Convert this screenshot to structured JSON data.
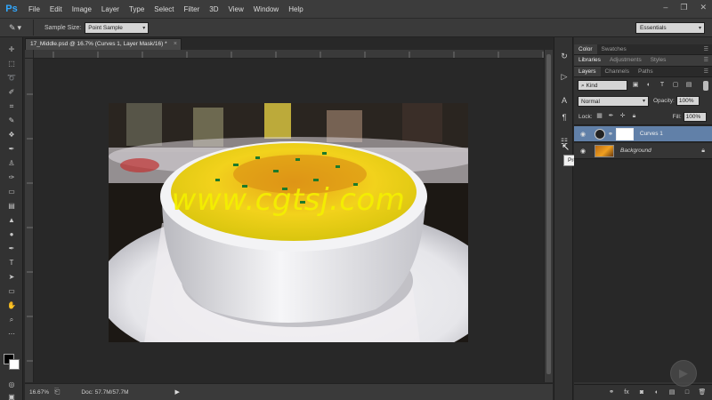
{
  "app": {
    "logo": "Ps",
    "menu": [
      "File",
      "Edit",
      "Image",
      "Layer",
      "Type",
      "Select",
      "Filter",
      "3D",
      "View",
      "Window",
      "Help"
    ],
    "window_controls": [
      "–",
      "❐",
      "✕"
    ]
  },
  "options_bar": {
    "sample_size_label": "Sample Size:",
    "sample_size_value": "Point Sample",
    "workspace": "Essentials"
  },
  "document": {
    "tab_title": "17_Middle.psd @ 16.7% (Curves 1, Layer Mask/16) *",
    "tab_close": "×",
    "watermark": "www.cgtsj.com"
  },
  "status_bar": {
    "zoom": "16.67%",
    "doc_size": "Doc: 57.7M/57.7M"
  },
  "tooltip": "Properties",
  "panels": {
    "row1_tabs": [
      "Color",
      "Swatches"
    ],
    "row2_tabs": [
      "Libraries",
      "Adjustments",
      "Styles"
    ],
    "row3_tabs": [
      "Layers",
      "Channels",
      "Paths"
    ],
    "filter_kind": "Kind",
    "blend_mode": "Normal",
    "opacity_label": "Opacity:",
    "opacity_value": "100%",
    "lock_label": "Lock:",
    "fill_label": "Fill:",
    "fill_value": "100%"
  },
  "layers": [
    {
      "name": "Curves 1",
      "selected": true,
      "kind": "adjustment"
    },
    {
      "name": "Background",
      "selected": false,
      "kind": "pixel",
      "locked": true
    }
  ],
  "colors": {
    "accent_selected_layer": "#6180a8",
    "watermark_color": "#f4f000",
    "ps_blue": "#31a8ff"
  }
}
